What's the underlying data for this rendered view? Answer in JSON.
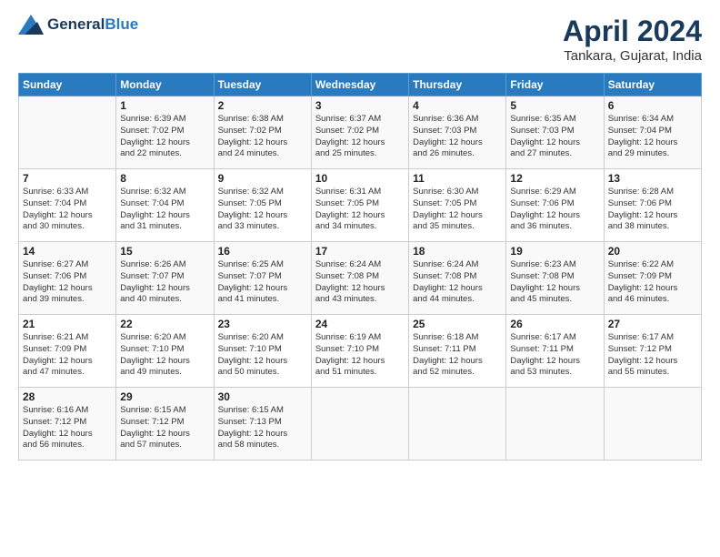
{
  "header": {
    "logo_line1": "General",
    "logo_line2": "Blue",
    "title": "April 2024",
    "location": "Tankara, Gujarat, India"
  },
  "columns": [
    "Sunday",
    "Monday",
    "Tuesday",
    "Wednesday",
    "Thursday",
    "Friday",
    "Saturday"
  ],
  "weeks": [
    [
      {
        "date": "",
        "info": ""
      },
      {
        "date": "1",
        "info": "Sunrise: 6:39 AM\nSunset: 7:02 PM\nDaylight: 12 hours\nand 22 minutes."
      },
      {
        "date": "2",
        "info": "Sunrise: 6:38 AM\nSunset: 7:02 PM\nDaylight: 12 hours\nand 24 minutes."
      },
      {
        "date": "3",
        "info": "Sunrise: 6:37 AM\nSunset: 7:02 PM\nDaylight: 12 hours\nand 25 minutes."
      },
      {
        "date": "4",
        "info": "Sunrise: 6:36 AM\nSunset: 7:03 PM\nDaylight: 12 hours\nand 26 minutes."
      },
      {
        "date": "5",
        "info": "Sunrise: 6:35 AM\nSunset: 7:03 PM\nDaylight: 12 hours\nand 27 minutes."
      },
      {
        "date": "6",
        "info": "Sunrise: 6:34 AM\nSunset: 7:04 PM\nDaylight: 12 hours\nand 29 minutes."
      }
    ],
    [
      {
        "date": "7",
        "info": "Sunrise: 6:33 AM\nSunset: 7:04 PM\nDaylight: 12 hours\nand 30 minutes."
      },
      {
        "date": "8",
        "info": "Sunrise: 6:32 AM\nSunset: 7:04 PM\nDaylight: 12 hours\nand 31 minutes."
      },
      {
        "date": "9",
        "info": "Sunrise: 6:32 AM\nSunset: 7:05 PM\nDaylight: 12 hours\nand 33 minutes."
      },
      {
        "date": "10",
        "info": "Sunrise: 6:31 AM\nSunset: 7:05 PM\nDaylight: 12 hours\nand 34 minutes."
      },
      {
        "date": "11",
        "info": "Sunrise: 6:30 AM\nSunset: 7:05 PM\nDaylight: 12 hours\nand 35 minutes."
      },
      {
        "date": "12",
        "info": "Sunrise: 6:29 AM\nSunset: 7:06 PM\nDaylight: 12 hours\nand 36 minutes."
      },
      {
        "date": "13",
        "info": "Sunrise: 6:28 AM\nSunset: 7:06 PM\nDaylight: 12 hours\nand 38 minutes."
      }
    ],
    [
      {
        "date": "14",
        "info": "Sunrise: 6:27 AM\nSunset: 7:06 PM\nDaylight: 12 hours\nand 39 minutes."
      },
      {
        "date": "15",
        "info": "Sunrise: 6:26 AM\nSunset: 7:07 PM\nDaylight: 12 hours\nand 40 minutes."
      },
      {
        "date": "16",
        "info": "Sunrise: 6:25 AM\nSunset: 7:07 PM\nDaylight: 12 hours\nand 41 minutes."
      },
      {
        "date": "17",
        "info": "Sunrise: 6:24 AM\nSunset: 7:08 PM\nDaylight: 12 hours\nand 43 minutes."
      },
      {
        "date": "18",
        "info": "Sunrise: 6:24 AM\nSunset: 7:08 PM\nDaylight: 12 hours\nand 44 minutes."
      },
      {
        "date": "19",
        "info": "Sunrise: 6:23 AM\nSunset: 7:08 PM\nDaylight: 12 hours\nand 45 minutes."
      },
      {
        "date": "20",
        "info": "Sunrise: 6:22 AM\nSunset: 7:09 PM\nDaylight: 12 hours\nand 46 minutes."
      }
    ],
    [
      {
        "date": "21",
        "info": "Sunrise: 6:21 AM\nSunset: 7:09 PM\nDaylight: 12 hours\nand 47 minutes."
      },
      {
        "date": "22",
        "info": "Sunrise: 6:20 AM\nSunset: 7:10 PM\nDaylight: 12 hours\nand 49 minutes."
      },
      {
        "date": "23",
        "info": "Sunrise: 6:20 AM\nSunset: 7:10 PM\nDaylight: 12 hours\nand 50 minutes."
      },
      {
        "date": "24",
        "info": "Sunrise: 6:19 AM\nSunset: 7:10 PM\nDaylight: 12 hours\nand 51 minutes."
      },
      {
        "date": "25",
        "info": "Sunrise: 6:18 AM\nSunset: 7:11 PM\nDaylight: 12 hours\nand 52 minutes."
      },
      {
        "date": "26",
        "info": "Sunrise: 6:17 AM\nSunset: 7:11 PM\nDaylight: 12 hours\nand 53 minutes."
      },
      {
        "date": "27",
        "info": "Sunrise: 6:17 AM\nSunset: 7:12 PM\nDaylight: 12 hours\nand 55 minutes."
      }
    ],
    [
      {
        "date": "28",
        "info": "Sunrise: 6:16 AM\nSunset: 7:12 PM\nDaylight: 12 hours\nand 56 minutes."
      },
      {
        "date": "29",
        "info": "Sunrise: 6:15 AM\nSunset: 7:12 PM\nDaylight: 12 hours\nand 57 minutes."
      },
      {
        "date": "30",
        "info": "Sunrise: 6:15 AM\nSunset: 7:13 PM\nDaylight: 12 hours\nand 58 minutes."
      },
      {
        "date": "",
        "info": ""
      },
      {
        "date": "",
        "info": ""
      },
      {
        "date": "",
        "info": ""
      },
      {
        "date": "",
        "info": ""
      }
    ]
  ]
}
